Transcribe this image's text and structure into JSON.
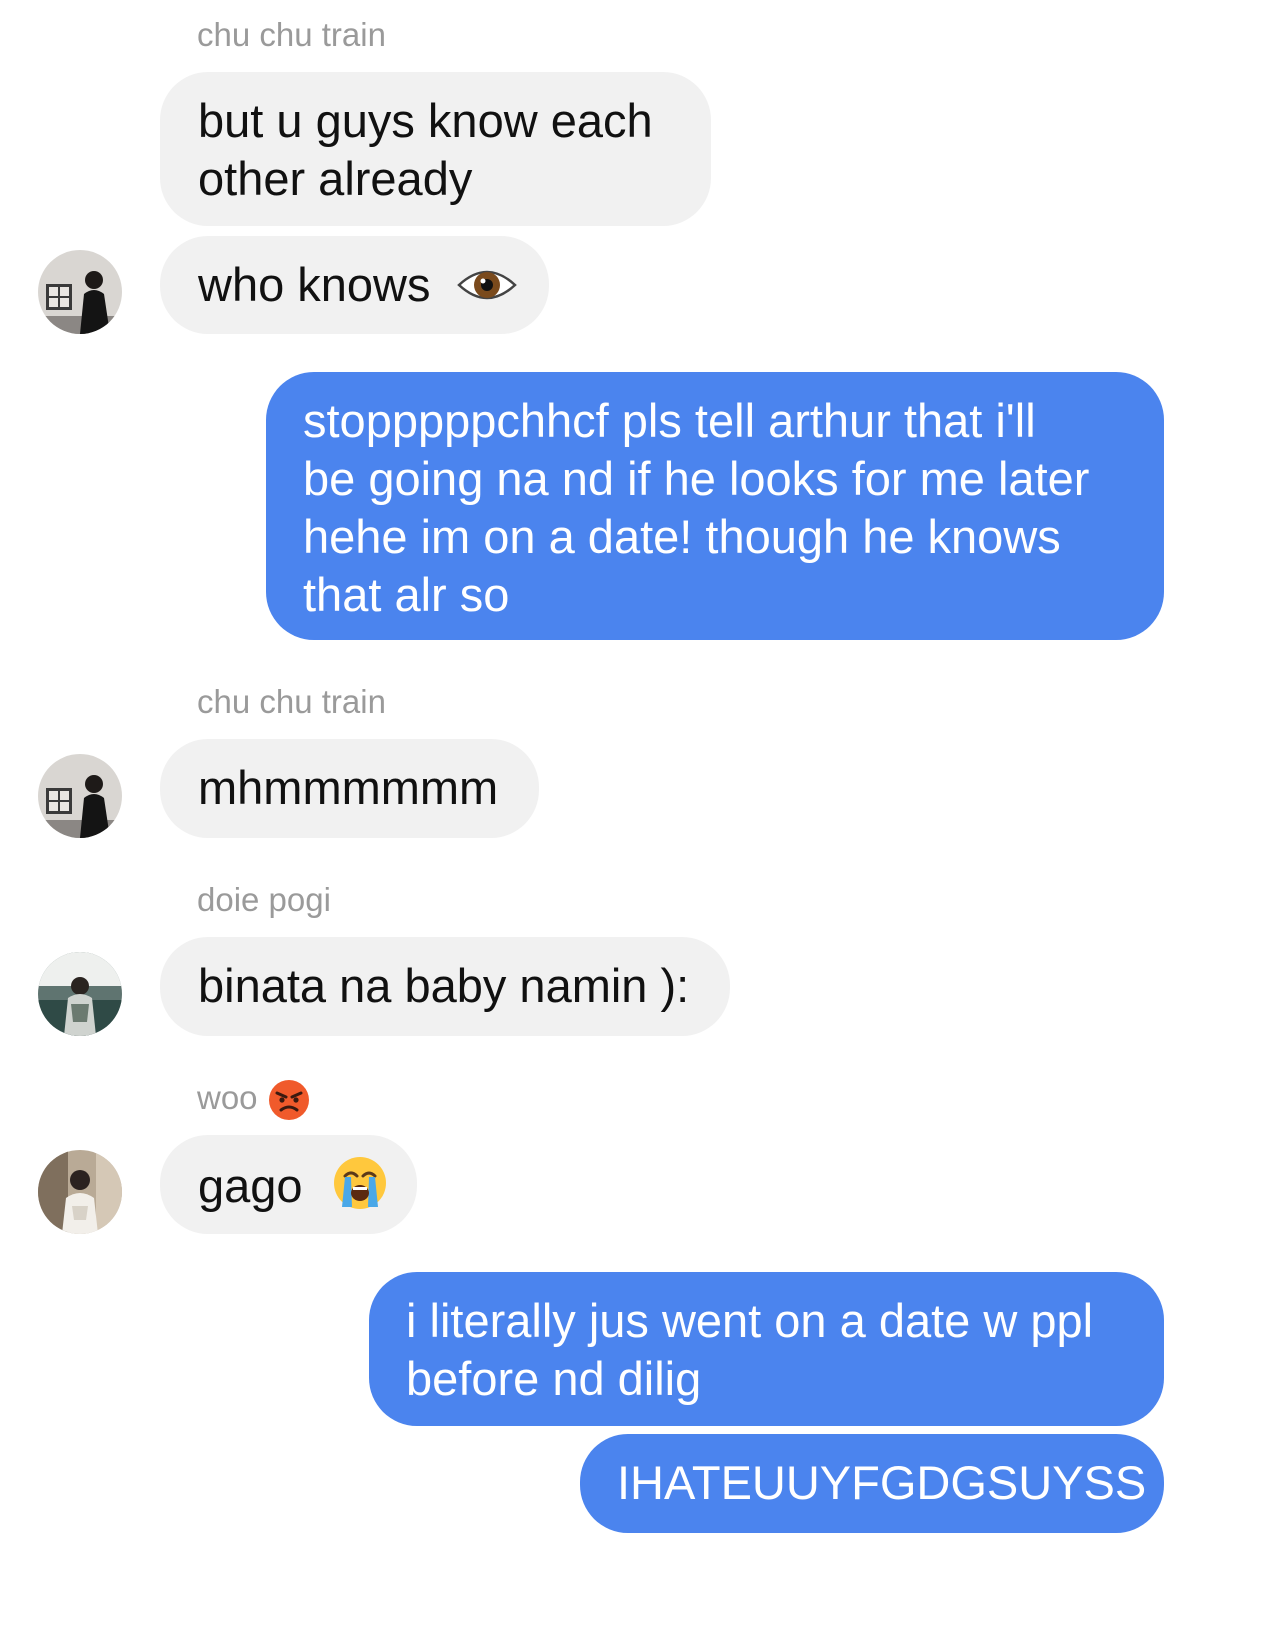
{
  "thread": {
    "messages": [
      {
        "sender": "chu chu train",
        "text_lines": [
          "but u guys know each",
          "other already"
        ],
        "direction": "incoming"
      },
      {
        "sender": "chu chu train",
        "text": "who knows",
        "emoji": "eye-icon",
        "direction": "incoming"
      },
      {
        "direction": "outgoing",
        "text_lines": [
          "stopppppchhcf pls tell arthur that i'll",
          "be going na nd if he looks for me later",
          "hehe im on a date! though he knows",
          "that alr so"
        ]
      },
      {
        "sender": "chu chu train",
        "text": "mhmmmmmm",
        "direction": "incoming"
      },
      {
        "sender": "doie pogi",
        "text": "binata na baby namin ):",
        "direction": "incoming"
      },
      {
        "sender": "woo",
        "sender_emoji": "angry-face-icon",
        "text": "gago",
        "emoji": "loudly-crying-face-icon",
        "direction": "incoming"
      },
      {
        "direction": "outgoing",
        "text_lines": [
          "i literally jus went on a date w ppl",
          "before nd dilig"
        ]
      },
      {
        "direction": "outgoing",
        "text": "IHATEUUYFGDGSUYSS"
      }
    ]
  },
  "colors": {
    "incoming_bubble": "#f1f1f1",
    "outgoing_bubble": "#4b84ee",
    "sender_name": "#9a9a9a"
  }
}
